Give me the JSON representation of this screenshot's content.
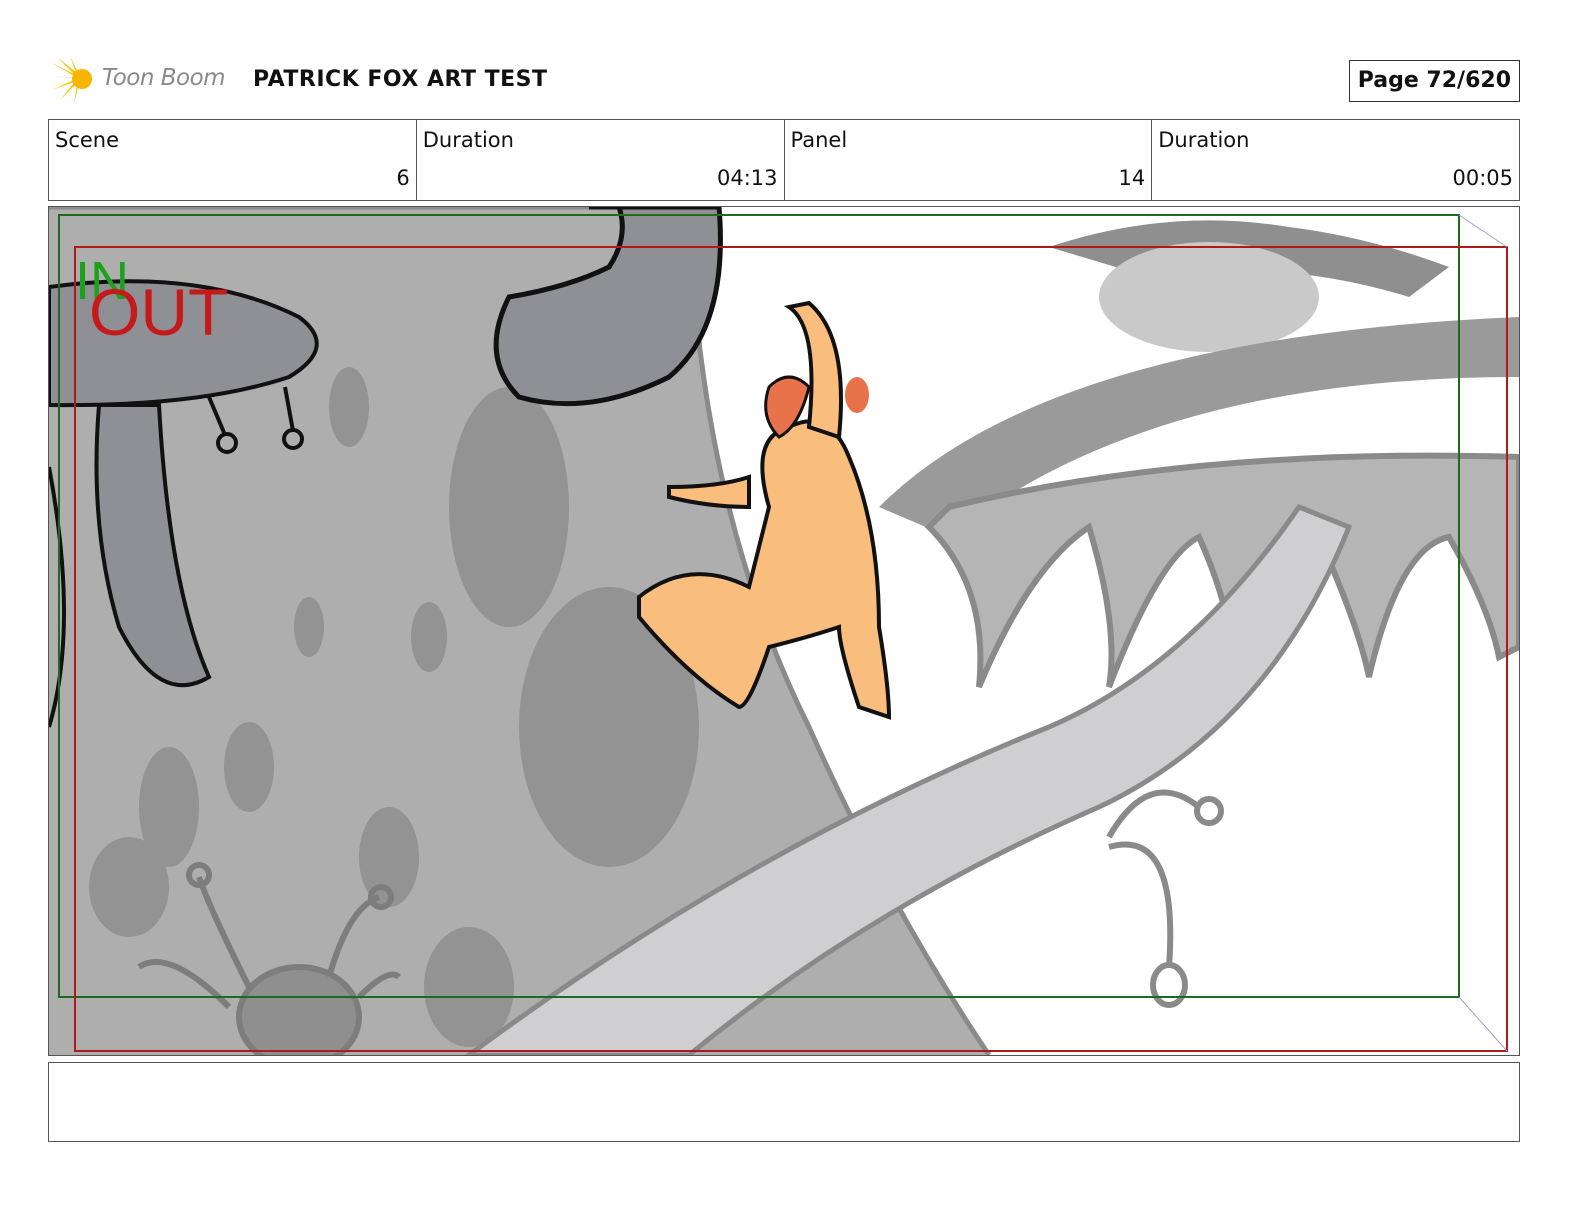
{
  "header": {
    "logo_text": "Toon Boom",
    "title": "PATRICK FOX ART TEST",
    "page_label": "Page",
    "page_value": "72/620"
  },
  "info": {
    "scene_label": "Scene",
    "scene_value": "6",
    "scene_duration_label": "Duration",
    "scene_duration_value": "04:13",
    "panel_label": "Panel",
    "panel_value": "14",
    "panel_duration_label": "Duration",
    "panel_duration_value": "00:05"
  },
  "frame": {
    "in_label": "IN",
    "out_label": "OUT",
    "in_color": "#1aa31a",
    "out_color": "#c41a1a"
  },
  "notes": {
    "text": ""
  },
  "colors": {
    "character_fill": "#f9bd7d",
    "character_face": "#e8734a",
    "tree_gray": "#a9a9a9",
    "dark_gray": "#8a8a8a",
    "light_gray": "#d4d4d6"
  }
}
